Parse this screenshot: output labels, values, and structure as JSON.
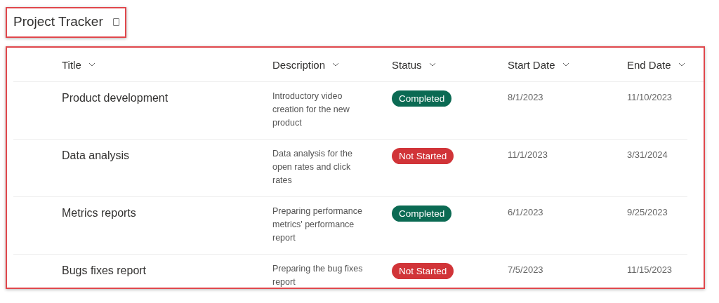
{
  "header": {
    "title": "Project Tracker"
  },
  "table": {
    "columns": [
      "Title",
      "Description",
      "Status",
      "Start Date",
      "End Date"
    ],
    "rows": [
      {
        "title": "Product development",
        "description": "Introductory video creation for the new product",
        "status": {
          "label": "Completed",
          "color": "#0b6a53"
        },
        "start_date": "8/1/2023",
        "end_date": "11/10/2023"
      },
      {
        "title": "Data analysis",
        "description": "Data analysis for the open rates and click rates",
        "status": {
          "label": "Not Started",
          "color": "#d13438"
        },
        "start_date": "11/1/2023",
        "end_date": "3/31/2024"
      },
      {
        "title": "Metrics reports",
        "description": "Preparing performance metrics' performance report",
        "status": {
          "label": "Completed",
          "color": "#0b6a53"
        },
        "start_date": "6/1/2023",
        "end_date": "9/25/2023"
      },
      {
        "title": "Bugs fixes report",
        "description": "Preparing the bug fixes report",
        "status": {
          "label": "Not Started",
          "color": "#d13438"
        },
        "start_date": "7/5/2023",
        "end_date": "11/15/2023"
      }
    ]
  }
}
